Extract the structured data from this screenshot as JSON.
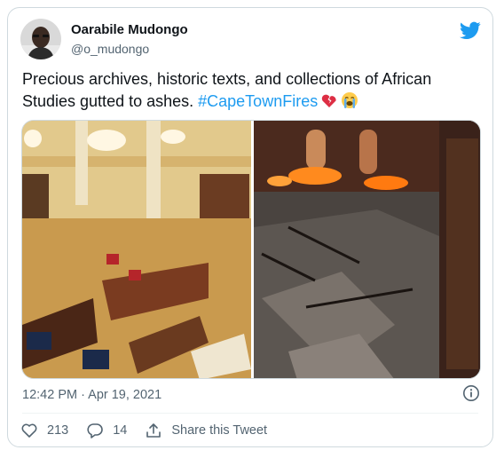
{
  "author": {
    "name": "Oarabile Mudongo",
    "handle": "@o_mudongo"
  },
  "tweet": {
    "text": "Precious archives, historic texts, and collections of African Studies gutted to ashes. ",
    "hashtag": "#CapeTownFires",
    "emojis": [
      "broken-heart-icon",
      "loudly-crying-face-icon"
    ]
  },
  "timestamp": "12:42 PM · Apr 19, 2021",
  "actions": {
    "likes": "213",
    "replies": "14",
    "share_label": "Share this Tweet"
  },
  "colors": {
    "accent": "#1d9bf0",
    "muted": "#536471",
    "border": "#cfd9de"
  }
}
